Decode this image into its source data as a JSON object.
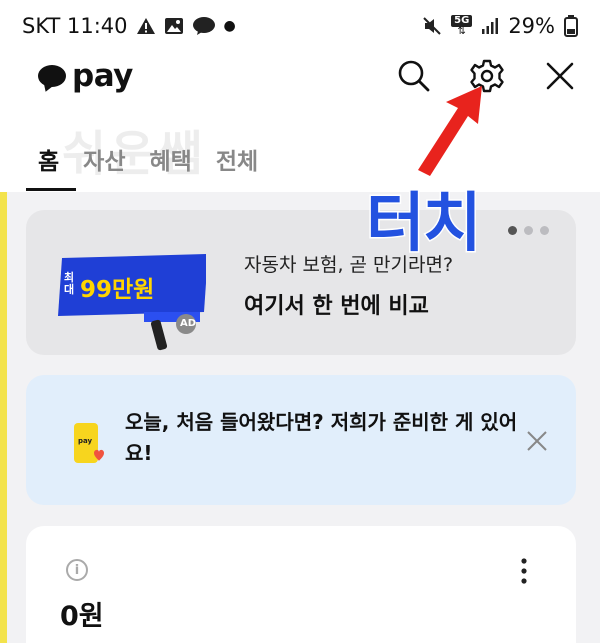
{
  "status_bar": {
    "carrier_time": "SKT 11:40",
    "talk_badge": "TALK",
    "network": "5G",
    "battery": "29%"
  },
  "app_bar": {
    "logo_text": "pay",
    "icons": [
      "search-icon",
      "gear-icon",
      "close-icon"
    ]
  },
  "watermark": "쉬운쌤",
  "tabs": [
    {
      "label": "홈",
      "active": true
    },
    {
      "label": "자산",
      "active": false
    },
    {
      "label": "혜택",
      "active": false
    },
    {
      "label": "전체",
      "active": false
    }
  ],
  "annotation": {
    "label": "터치",
    "color": "#2352e0",
    "arrow_color": "#e8231d"
  },
  "ad_card": {
    "banner_prefix": "최대",
    "banner_amount": "99만원",
    "banner_tag": "AD",
    "line1": "자동차 보험, 곧 만기라면?",
    "line2": "여기서 한 번에 비교"
  },
  "notice_card": {
    "text": "오늘, 처음 들어왔다면? 저희가 준비한 게 있어요!"
  },
  "balance_card": {
    "info_glyph": "i",
    "amount": "0원"
  },
  "colors": {
    "kakao_yellow": "#f3e34c",
    "notice_bg": "#e1eefb",
    "ad_bg": "#e6e6e8"
  }
}
